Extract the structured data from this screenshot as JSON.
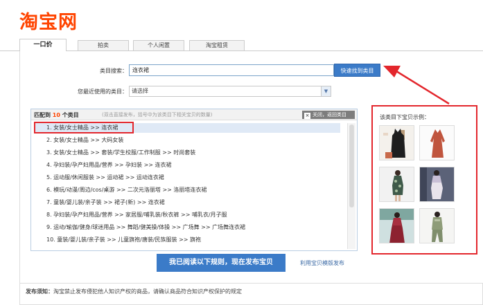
{
  "logo": "淘宝网",
  "tabs": [
    "一口价",
    "拍卖",
    "个人闲置",
    "淘宝租赁"
  ],
  "form": {
    "category_search_label": "类目搜索：",
    "category_search_value": "连衣裙",
    "search_button": "快速找到类目",
    "recent_label": "您最近使用的类目：",
    "recent_select": "请选择"
  },
  "match": {
    "prefix": "匹配到",
    "count": "10",
    "suffix": "个类目",
    "hint": "(双击直接发布，括号中为该类目下相关宝贝的数量)",
    "close": "关闭，返回类目",
    "close_x": "×",
    "items": [
      "1.  女装/女士精品 >> 连衣裙",
      "2.  女装/女士精品 >> 大码女装",
      "3.  女装/女士精品 >> 套装/学生校服/工作制服 >> 时尚套装",
      "4.  孕妇装/孕产妇用品/营养 >> 孕妇装 >> 连衣裙",
      "5.  运动服/休闲服装 >> 运动裙 >> 运动连衣裙",
      "6.  模玩/动漫/周边/cos/桌游 >> 二次元洛丽塔 >> 洛丽塔连衣裙",
      "7.  童装/婴儿装/亲子装 >> 裙子(新) >> 连衣裙",
      "8.  孕妇装/孕产妇用品/营养 >> 家居服/哺乳装/秋衣裤 >> 哺乳衣/月子服",
      "9.  运动/瑜伽/健身/球迷用品 >> 舞蹈/健美操/体操 >> 广场舞 >> 广场舞连衣裙",
      "10. 童装/婴儿装/亲子装 >> 儿童旗袍/唐装/民族服装 >> 旗袍"
    ]
  },
  "examples": {
    "title": "该类目下宝贝示例：",
    "thumbs": [
      "black-dress-photo",
      "red-dress-photo",
      "floral-dress-model-photo",
      "lace-dress-model-photo",
      "red-velvet-dress-photo",
      "green-outfit-photo"
    ]
  },
  "publish_button": "我已阅读以下规则，现在发布宝贝",
  "template_link": "利用宝贝模版发布",
  "notice": {
    "label": "发布须知：",
    "text": "淘宝禁止发布侵犯他人知识产权的商品，请确认商品符合知识产权保护的规定"
  },
  "colors": {
    "brand": "#ff4400",
    "button_blue": "#3b7bc8",
    "annotation_red": "#e3262c"
  }
}
